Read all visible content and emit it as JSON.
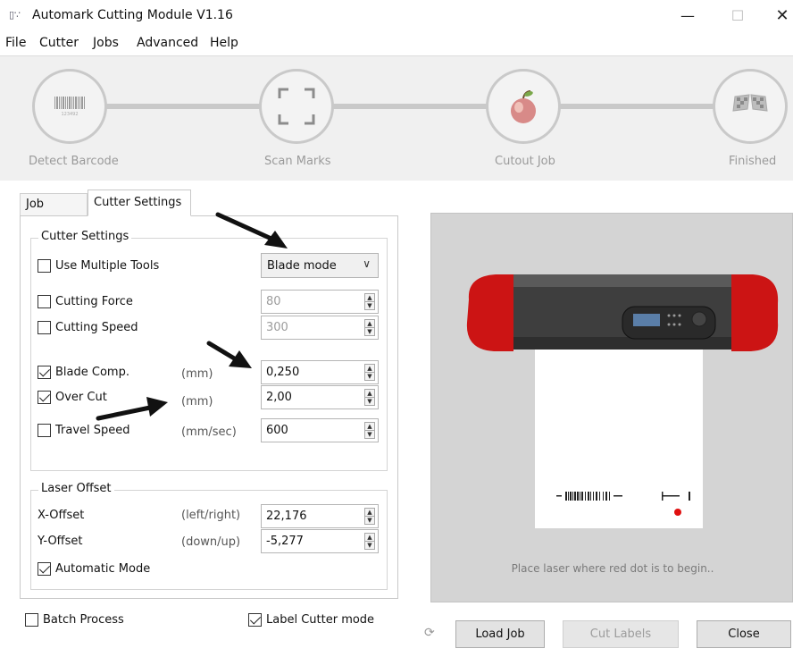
{
  "window": {
    "title": "Automark Cutting Module V1.16",
    "min_glyph": "—",
    "max_glyph": "☐",
    "close_glyph": "✕"
  },
  "menu": [
    "File",
    "Cutter",
    "Jobs",
    "Advanced",
    "Help"
  ],
  "steps": [
    {
      "label": "Detect Barcode",
      "icon": "barcode-icon",
      "barcode_digits": "123492"
    },
    {
      "label": "Scan Marks",
      "icon": "scan-marks-icon"
    },
    {
      "label": "Cutout Job",
      "icon": "apple-icon"
    },
    {
      "label": "Finished",
      "icon": "checkered-flags-icon"
    }
  ],
  "tabs": {
    "job_status": "Job Status",
    "cutter_settings": "Cutter Settings"
  },
  "cutter_settings": {
    "group_title": "Cutter Settings",
    "use_multiple_tools": {
      "label": "Use Multiple Tools",
      "checked": false
    },
    "mode_dropdown": {
      "value": "Blade mode",
      "chevron": "∨"
    },
    "cutting_force": {
      "label": "Cutting Force",
      "checked": false,
      "value": "80"
    },
    "cutting_speed": {
      "label": "Cutting Speed",
      "checked": false,
      "value": "300"
    },
    "blade_comp": {
      "label": "Blade Comp.",
      "checked": true,
      "unit": "(mm)",
      "value": "0,250"
    },
    "over_cut": {
      "label": "Over Cut",
      "checked": true,
      "unit": "(mm)",
      "value": "2,00"
    },
    "travel_speed": {
      "label": "Travel Speed",
      "checked": false,
      "unit": "(mm/sec)",
      "value": "600"
    }
  },
  "laser_offset": {
    "group_title": "Laser Offset",
    "x_offset": {
      "label": "X-Offset",
      "unit": "(left/right)",
      "value": "22,176"
    },
    "y_offset": {
      "label": "Y-Offset",
      "unit": "(down/up)",
      "value": "-5,277"
    },
    "automatic_mode": {
      "label": "Automatic Mode",
      "checked": true
    }
  },
  "bottom_options": {
    "batch_process": {
      "label": "Batch Process",
      "checked": false
    },
    "label_cutter_mode": {
      "label": "Label Cutter mode",
      "checked": true
    }
  },
  "preview": {
    "hint": "Place laser where red dot is to begin.."
  },
  "buttons": {
    "load_job": "Load Job",
    "cut_labels": "Cut Labels",
    "close": "Close",
    "refresh_glyph": "⟳"
  },
  "spin_glyphs": {
    "up": "▲",
    "down": "▼"
  },
  "colors": {
    "cutter_red": "#cc1414",
    "laser_dot": "#e01010",
    "progress_bg": "#f0f0f0",
    "preview_bg": "#d4d4d4"
  }
}
